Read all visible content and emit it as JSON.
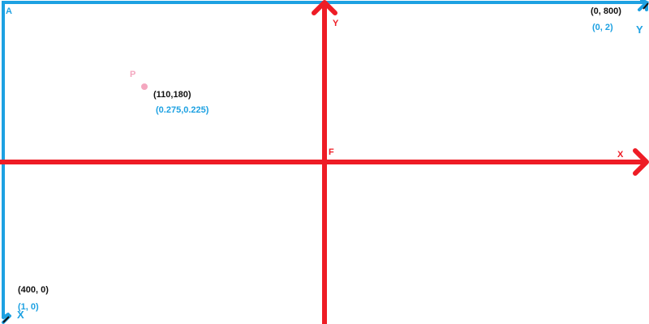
{
  "colors": {
    "blue": "#1da1e2",
    "red": "#ee1c25",
    "black": "#111111",
    "pink": "#f4a7bf",
    "background": "#ffffff"
  },
  "labels": {
    "corner_a": "A",
    "center_f": "F",
    "red_axis_x": "X",
    "red_axis_y": "Y",
    "blue_axis_x": "X",
    "blue_axis_y": "Y",
    "point_p": "P",
    "p_pixel_coords": "(110,180)",
    "p_normalized_coords": "(0.275,0.225)",
    "topright_pixel_coords": "(0,  800)",
    "topright_normalized_coords": "(0,  2)",
    "bottomleft_pixel_coords": "(400,  0)",
    "bottomleft_normalized_coords": "(1,  0)"
  }
}
